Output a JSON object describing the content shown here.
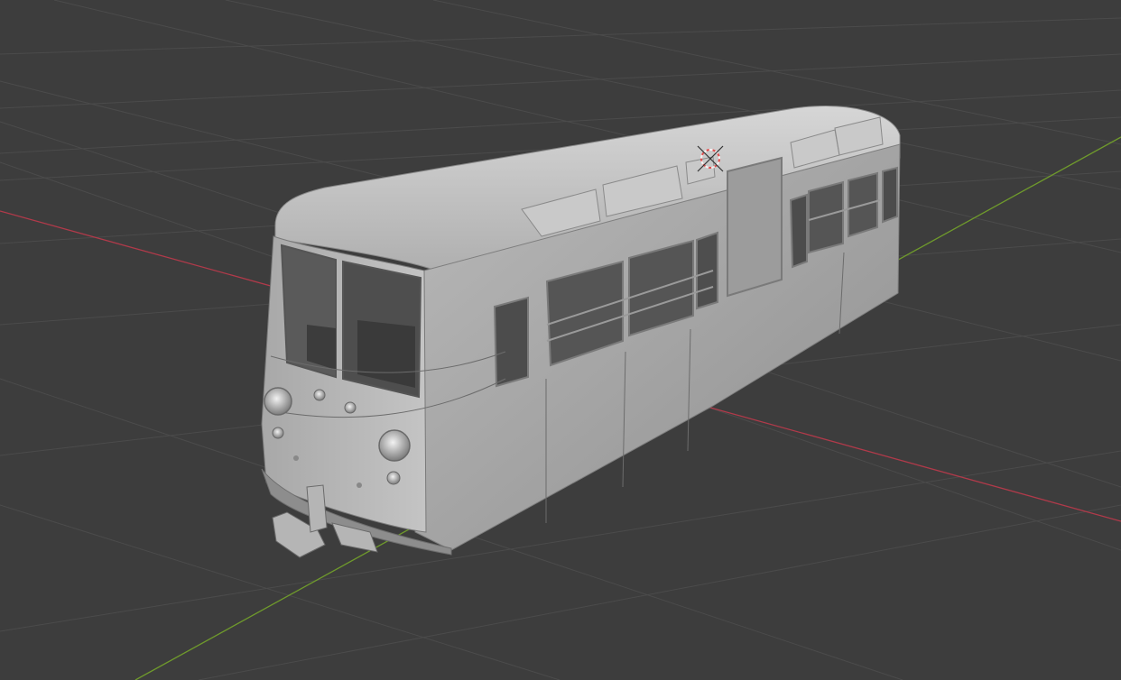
{
  "app": {
    "editor": "3d-viewport"
  },
  "viewport": {
    "background_color": "#3d3d3d",
    "grid_color": "#4a4a4a",
    "x_axis_color": "#b03a4a",
    "y_axis_color": "#6f9a2c",
    "grid_visible": true
  },
  "scene": {
    "object": {
      "name": "railcar-model",
      "shading": "solid",
      "color": "#b8b8b8"
    },
    "origin_marker": {
      "icon": "3d-cursor-icon",
      "color": "#e05050"
    }
  }
}
